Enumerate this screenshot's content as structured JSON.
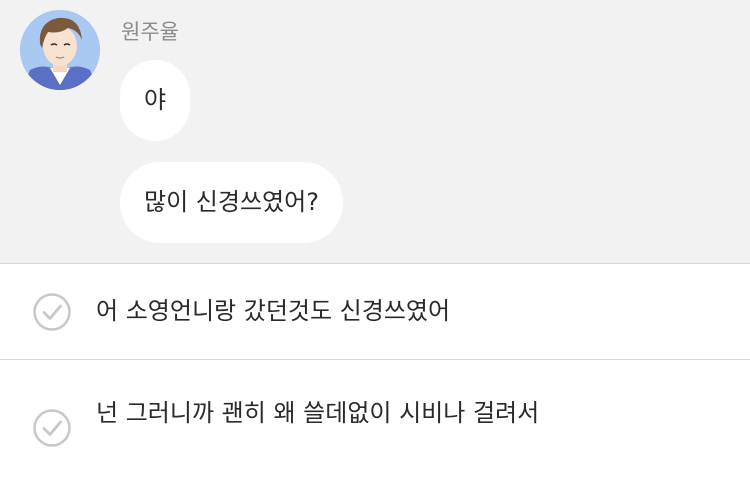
{
  "message": {
    "sender": "원주율",
    "bubbles": [
      "야",
      "많이 신경쓰였어?"
    ]
  },
  "reply_options": [
    {
      "text": "어 소영언니랑 갔던것도 신경쓰였어"
    },
    {
      "text": "넌 그러니까 괜히 왜 쓸데없이 시비나 걸려서"
    }
  ],
  "colors": {
    "chat_background": "#f2f2f2",
    "bubble": "#ffffff",
    "sender_name": "#8c8c8c",
    "check_icon": "#c8c8c8",
    "divider": "#d6d6d6"
  }
}
